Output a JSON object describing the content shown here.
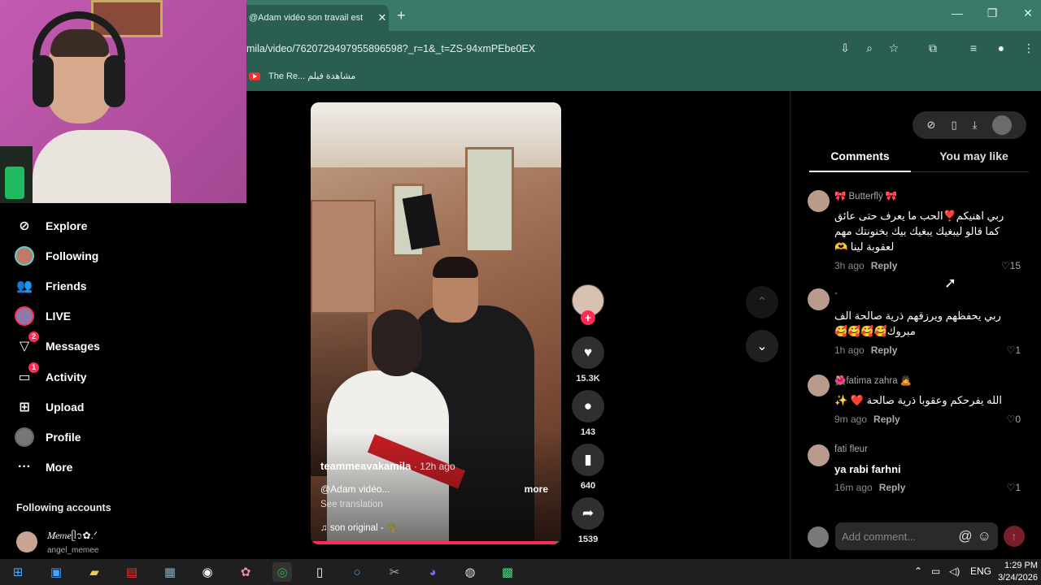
{
  "browser": {
    "tab_title": "@Adam vidéo son travail est",
    "tab_close": "✕",
    "new_tab": "+",
    "url": "amila/video/7620729497955896598?_r=1&_t=ZS-94xmPEbe0EX",
    "bookmark_label": "The Re... مشاهدة فيلم",
    "window_controls": [
      "—",
      "❐",
      "✕"
    ]
  },
  "sidebar": {
    "items": [
      {
        "label": "Explore",
        "icon": "compass-icon"
      },
      {
        "label": "Following",
        "icon": "following-avatar"
      },
      {
        "label": "Friends",
        "icon": "friends-icon"
      },
      {
        "label": "LIVE",
        "icon": "live-icon"
      },
      {
        "label": "Messages",
        "icon": "messages-icon",
        "badge": "2"
      },
      {
        "label": "Activity",
        "icon": "activity-icon",
        "badge": "1"
      },
      {
        "label": "Upload",
        "icon": "upload-icon"
      },
      {
        "label": "Profile",
        "icon": "profile-icon"
      },
      {
        "label": "More",
        "icon": "more-icon"
      }
    ],
    "following_accounts_title": "Following accounts",
    "account": {
      "name": "𝑀𝑒𝑚𝑒ᥫ᭡✿.ᐟ",
      "handle": "angel_memee"
    }
  },
  "video": {
    "author": "teammeavakamila",
    "time": "· 12h ago",
    "description": "@Adam vidéo...",
    "more": "more",
    "see_translation": "See translation",
    "music": "♫  son original - 🌴",
    "progress": 0.98
  },
  "actions": {
    "likes": "15.3K",
    "comments": "143",
    "saves": "640",
    "shares": "1539"
  },
  "panel": {
    "tab_comments": "Comments",
    "tab_you_may_like": "You may like",
    "add_comment_placeholder": "Add comment...",
    "reply_label": "Reply",
    "comments": [
      {
        "user": "🎀 Butterflÿ 🎀",
        "text": "ربي اهنيكم❣️الحب ما يعرف حتى عائق كما قالو ليبغيك يبغيك بيك بخنونتك مهم لعقوبة لينا 🫶",
        "time": "3h ago",
        "likes": "15"
      },
      {
        "user": "-",
        "text": "ربي يحفظهم ويرزقهم ذرية صالحة الف مبروك🥰🥰🥰🥰",
        "time": "1h ago",
        "likes": "1"
      },
      {
        "user": "🌺fatima zahra 🙇",
        "text": "الله يفرحكم وعقوبا ذرية صالحة ❤️ ✨",
        "time": "9m ago",
        "likes": "0"
      },
      {
        "user": "fati fleur",
        "text": "ya rabi farhni",
        "time": "16m ago",
        "likes": "1"
      }
    ]
  },
  "taskbar": {
    "lang": "ENG",
    "time": "1:29 PM",
    "date": "3/24/2026"
  },
  "colors": {
    "accent": "#fe2c55",
    "chrome": "#2b5e52",
    "tab_strip": "#3a7a6a"
  }
}
